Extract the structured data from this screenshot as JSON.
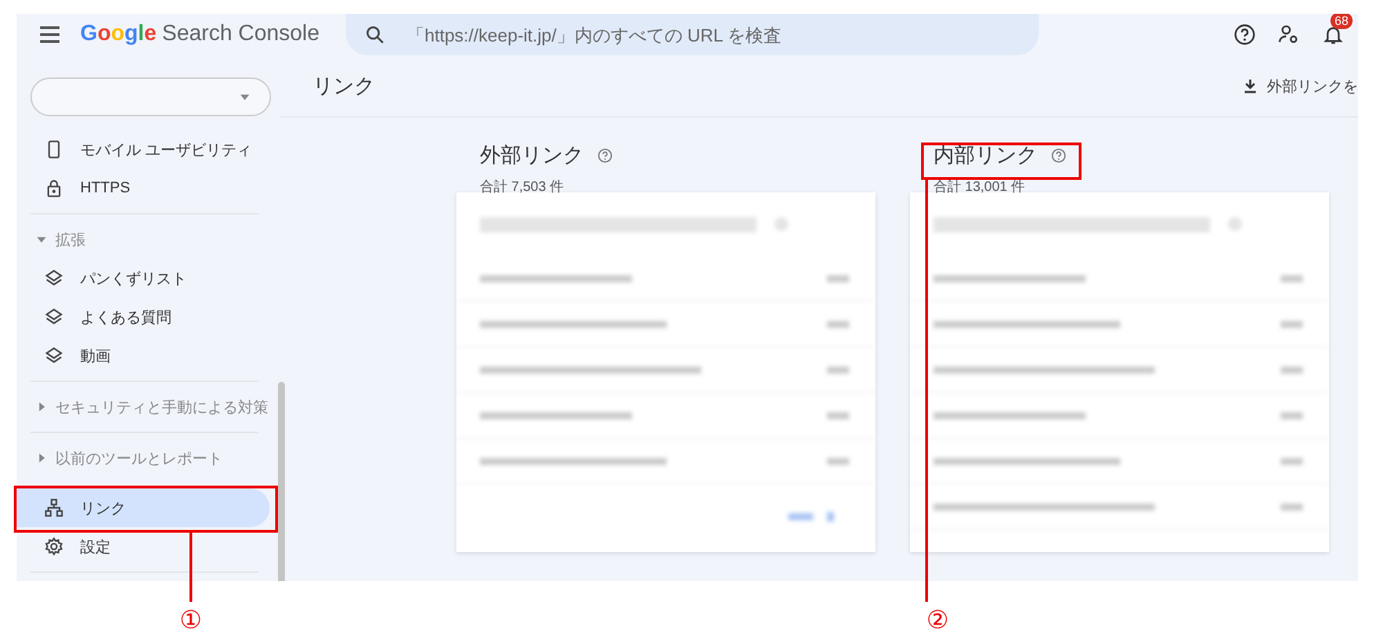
{
  "header": {
    "logo": {
      "brand": "Google",
      "product": "Search Console"
    },
    "search": {
      "placeholder": "「https://keep-it.jp/」内のすべての URL を検査"
    },
    "notifications": {
      "count": "68"
    }
  },
  "sidebar": {
    "items": [
      {
        "kind": "item",
        "label": "モバイル ユーザビリティ",
        "selected": false
      },
      {
        "kind": "item",
        "label": "HTTPS",
        "selected": false
      },
      {
        "kind": "group",
        "label": "拡張",
        "expanded": true,
        "children": [
          {
            "kind": "item",
            "label": "パンくずリスト",
            "selected": false
          },
          {
            "kind": "item",
            "label": "よくある質問",
            "selected": false
          },
          {
            "kind": "item",
            "label": "動画",
            "selected": false
          }
        ]
      },
      {
        "kind": "group",
        "label": "セキュリティと手動による対策",
        "expanded": false
      },
      {
        "kind": "group",
        "label": "以前のツールとレポート",
        "expanded": false
      },
      {
        "kind": "item",
        "label": "リンク",
        "selected": true
      },
      {
        "kind": "item",
        "label": "設定",
        "selected": false
      }
    ]
  },
  "main": {
    "title": "リンク",
    "export_button": "外部リンクを",
    "sections": [
      {
        "title": "外部リンク",
        "total": "合計 7,503 件"
      },
      {
        "title": "内部リンク",
        "total": "合計 13,001 件"
      }
    ]
  },
  "annotations": [
    {
      "label": "①"
    },
    {
      "label": "②"
    }
  ]
}
